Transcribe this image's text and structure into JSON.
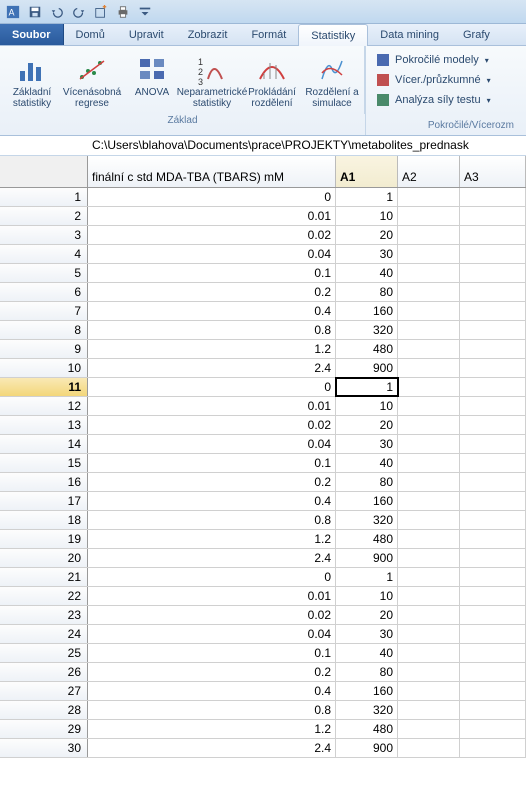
{
  "qat": {
    "items": [
      "logo",
      "save",
      "undo",
      "redo",
      "add",
      "print",
      "options"
    ]
  },
  "menu": {
    "file": "Soubor",
    "items": [
      "Domů",
      "Upravit",
      "Zobrazit",
      "Formát",
      "Statistiky",
      "Data mining",
      "Grafy"
    ],
    "active_index": 4
  },
  "ribbon": {
    "buttons": [
      {
        "label": "Základní statistiky",
        "icon": "basic"
      },
      {
        "label": "Vícenásobná regrese",
        "icon": "regression"
      },
      {
        "label": "ANOVA",
        "icon": "anova"
      },
      {
        "label": "Neparametrické statistiky",
        "icon": "nonparam"
      },
      {
        "label": "Prokládání rozdělení",
        "icon": "fit"
      },
      {
        "label": "Rozdělení a simulace",
        "icon": "sim"
      }
    ],
    "group_label": "Základ",
    "right": [
      {
        "icon": "adv",
        "label": "Pokročilé modely",
        "chev": true
      },
      {
        "icon": "multi",
        "label": "Vícer./průzkumné",
        "chev": true
      },
      {
        "icon": "power",
        "label": "Analýza síly testu",
        "chev": true
      }
    ],
    "footer": "Pokročilé/Vícerozm"
  },
  "path": "C:\\Users\\blahova\\Documents\\prace\\PROJEKTY\\metabolites_prednask",
  "columns": [
    "finální c std MDA-TBA (TBARS) mM",
    "A1",
    "A2",
    "A3"
  ],
  "selected_row": 11,
  "rows": [
    {
      "n": 1,
      "c1": "0",
      "c2": "1"
    },
    {
      "n": 2,
      "c1": "0.01",
      "c2": "10"
    },
    {
      "n": 3,
      "c1": "0.02",
      "c2": "20"
    },
    {
      "n": 4,
      "c1": "0.04",
      "c2": "30"
    },
    {
      "n": 5,
      "c1": "0.1",
      "c2": "40"
    },
    {
      "n": 6,
      "c1": "0.2",
      "c2": "80"
    },
    {
      "n": 7,
      "c1": "0.4",
      "c2": "160"
    },
    {
      "n": 8,
      "c1": "0.8",
      "c2": "320"
    },
    {
      "n": 9,
      "c1": "1.2",
      "c2": "480"
    },
    {
      "n": 10,
      "c1": "2.4",
      "c2": "900"
    },
    {
      "n": 11,
      "c1": "0",
      "c2": "1"
    },
    {
      "n": 12,
      "c1": "0.01",
      "c2": "10"
    },
    {
      "n": 13,
      "c1": "0.02",
      "c2": "20"
    },
    {
      "n": 14,
      "c1": "0.04",
      "c2": "30"
    },
    {
      "n": 15,
      "c1": "0.1",
      "c2": "40"
    },
    {
      "n": 16,
      "c1": "0.2",
      "c2": "80"
    },
    {
      "n": 17,
      "c1": "0.4",
      "c2": "160"
    },
    {
      "n": 18,
      "c1": "0.8",
      "c2": "320"
    },
    {
      "n": 19,
      "c1": "1.2",
      "c2": "480"
    },
    {
      "n": 20,
      "c1": "2.4",
      "c2": "900"
    },
    {
      "n": 21,
      "c1": "0",
      "c2": "1"
    },
    {
      "n": 22,
      "c1": "0.01",
      "c2": "10"
    },
    {
      "n": 23,
      "c1": "0.02",
      "c2": "20"
    },
    {
      "n": 24,
      "c1": "0.04",
      "c2": "30"
    },
    {
      "n": 25,
      "c1": "0.1",
      "c2": "40"
    },
    {
      "n": 26,
      "c1": "0.2",
      "c2": "80"
    },
    {
      "n": 27,
      "c1": "0.4",
      "c2": "160"
    },
    {
      "n": 28,
      "c1": "0.8",
      "c2": "320"
    },
    {
      "n": 29,
      "c1": "1.2",
      "c2": "480"
    },
    {
      "n": 30,
      "c1": "2.4",
      "c2": "900"
    }
  ]
}
